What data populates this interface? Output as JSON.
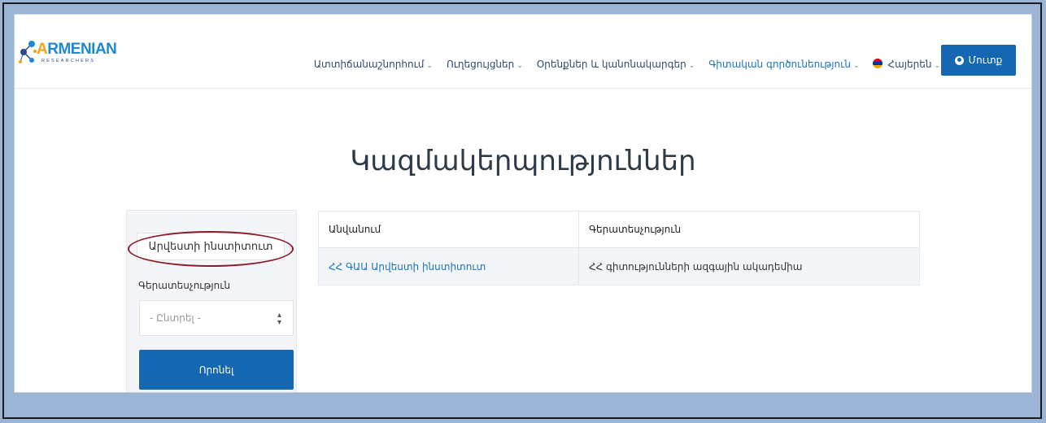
{
  "brand": {
    "name_accent": "A",
    "name_rest": "RMENIAN",
    "subtitle": "RESEARCHERS"
  },
  "nav": {
    "items": [
      {
        "label": "Ատտիճանաշնորհում",
        "active": false
      },
      {
        "label": "Ուղեցույցներ",
        "active": false
      },
      {
        "label": "Օրենքներ և կանոնակարգեր",
        "active": false
      },
      {
        "label": "Գիտական գործունեություն",
        "active": true
      }
    ],
    "language": "Հայերեն",
    "login_label": "Մուտք"
  },
  "page": {
    "title": "Կազմակերպություններ"
  },
  "sidebar": {
    "filter_chip": "Արվեստի ինստիտուտ",
    "department_label": "Գերատեսչություն",
    "select_placeholder": "- Ընտրել -",
    "search_button": "Որոնել"
  },
  "table": {
    "headers": [
      "Անվանում",
      "Գերատեսչություն"
    ],
    "rows": [
      [
        "ՀՀ ԳԱԱ Արվեստի ինստիտուտ",
        "ՀՀ գիտությունների ազգային ակադեմիա"
      ]
    ]
  },
  "colors": {
    "accent": "#1567b1",
    "link": "#1a73c4",
    "annotation": "#8b1d2a",
    "background": "#9cb5d7"
  }
}
